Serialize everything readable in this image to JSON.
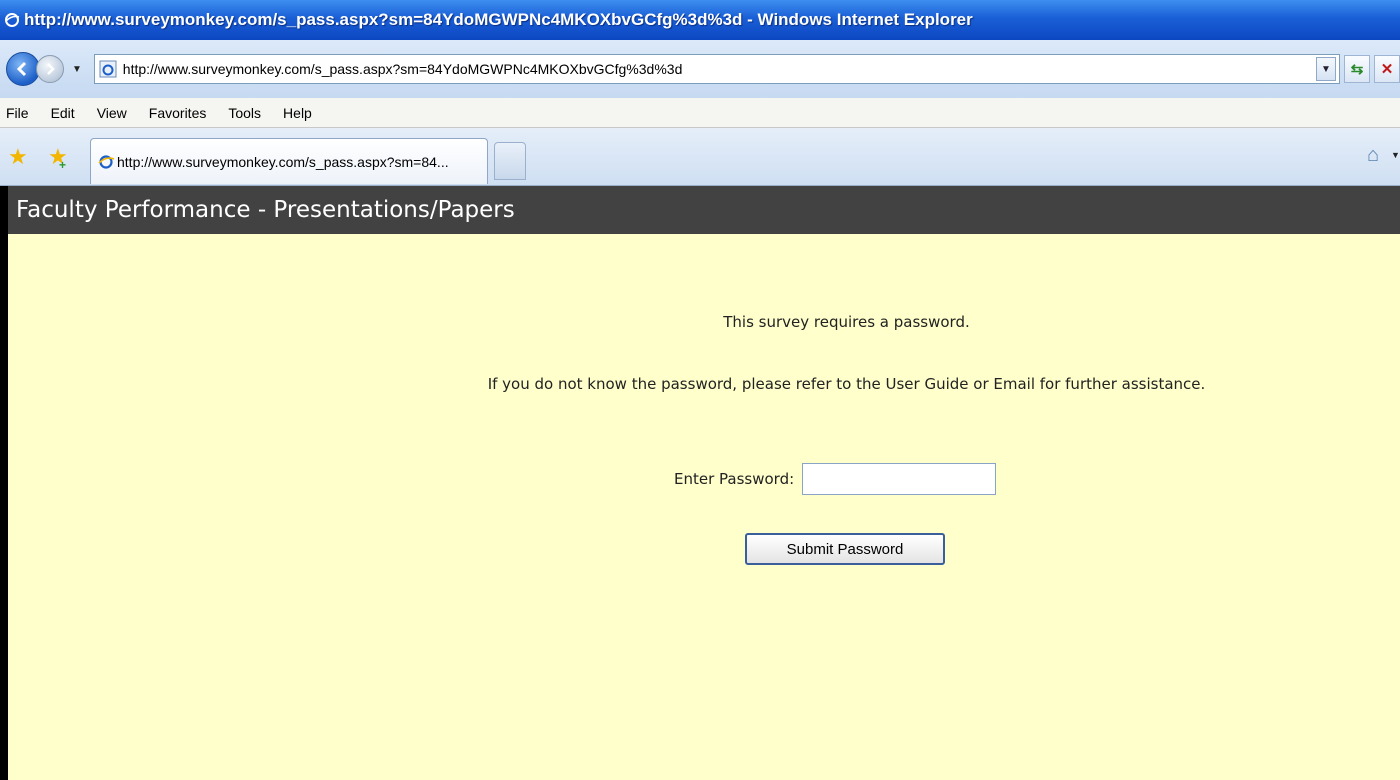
{
  "window": {
    "title": "http://www.surveymonkey.com/s_pass.aspx?sm=84YdoMGWPNc4MKOXbvGCfg%3d%3d - Windows Internet Explorer"
  },
  "address_bar": {
    "url": "http://www.surveymonkey.com/s_pass.aspx?sm=84YdoMGWPNc4MKOXbvGCfg%3d%3d"
  },
  "menu": {
    "items": [
      "File",
      "Edit",
      "View",
      "Favorites",
      "Tools",
      "Help"
    ]
  },
  "tabs": {
    "active_title": "http://www.surveymonkey.com/s_pass.aspx?sm=84..."
  },
  "icons": {
    "ie_logo": "ie-logo-icon",
    "back": "back-arrow-icon",
    "forward": "forward-arrow-icon",
    "refresh": "refresh-icon",
    "stop": "stop-icon",
    "favorites": "favorites-star-icon",
    "add_favorites": "add-favorites-icon",
    "home": "home-icon"
  },
  "survey": {
    "header_title": "Faculty Performance - Presentations/Papers",
    "message_required": "This survey requires a password.",
    "message_help": "If you do not know the password, please refer to the User Guide or Email for further assistance.",
    "password_label": "Enter Password:",
    "password_value": "",
    "submit_label": "Submit Password"
  },
  "colors": {
    "page_background": "#ffffcc",
    "header_background": "#424242",
    "titlebar_blue": "#1a5fd6"
  }
}
